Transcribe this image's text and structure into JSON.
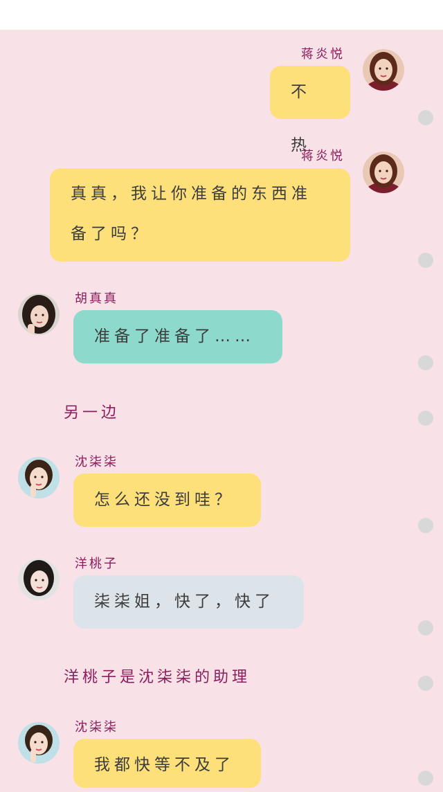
{
  "messages": [
    {
      "sender": "蒋炎悦",
      "text": "不热"
    },
    {
      "sender": "蒋炎悦",
      "text_line1": "真真，我让你准备的东西准",
      "text_line2": "备了吗？"
    },
    {
      "sender": "胡真真",
      "text": "准备了准备了……"
    },
    {
      "sender": "沈柒柒",
      "text": "怎么还没到哇？"
    },
    {
      "sender": "洋桃子",
      "text": "柒柒姐，快了，快了"
    },
    {
      "sender": "沈柒柒",
      "text": "我都快等不及了"
    }
  ],
  "narration": {
    "elsewhere": "另一边",
    "assistant_note": "洋桃子是沈柒柒的助理"
  },
  "colors": {
    "background": "#f9e1e8",
    "bubble_yellow": "#fde07a",
    "bubble_teal": "#8dd9cc",
    "bubble_grey": "#dce4ea",
    "name_color": "#8b1d5a"
  },
  "icons": [
    "avatar-jiang-yanyue",
    "avatar-hu-zhenzhen",
    "avatar-shen-qiqi",
    "avatar-yang-taozi",
    "scroll-dot"
  ]
}
